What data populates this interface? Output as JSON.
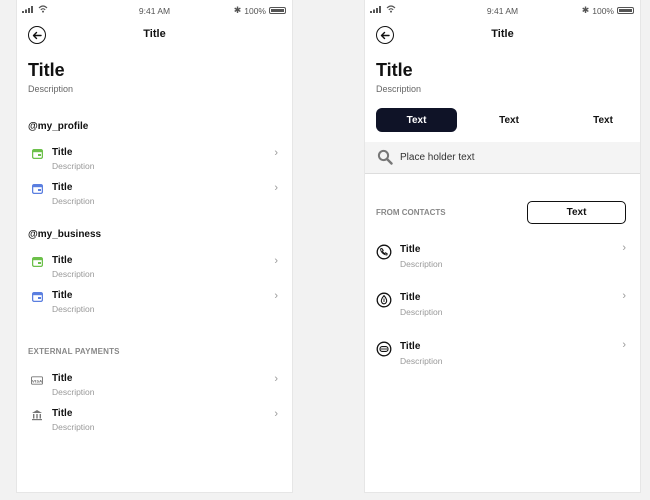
{
  "status_bar": {
    "time": "9:41 AM",
    "battery": "100%"
  },
  "left_screen": {
    "nav_title": "Title",
    "header": {
      "title": "Title",
      "description": "Description"
    },
    "section_profile": {
      "heading": "@my_profile",
      "items": [
        {
          "title": "Title",
          "description": "Description",
          "icon": "green-card-icon"
        },
        {
          "title": "Title",
          "description": "Description",
          "icon": "blue-card-icon"
        }
      ]
    },
    "section_business": {
      "heading": "@my_business",
      "items": [
        {
          "title": "Title",
          "description": "Description",
          "icon": "green-card-icon"
        },
        {
          "title": "Title",
          "description": "Description",
          "icon": "blue-card-icon"
        }
      ]
    },
    "section_external": {
      "heading": "EXTERNAL PAYMENTS",
      "items": [
        {
          "title": "Title",
          "description": "Description",
          "icon": "visa-card-icon"
        },
        {
          "title": "Title",
          "description": "Description",
          "icon": "bank-icon"
        }
      ]
    }
  },
  "right_screen": {
    "nav_title": "Title",
    "header": {
      "title": "Title",
      "description": "Description"
    },
    "segments": [
      "Text",
      "Text",
      "Text"
    ],
    "search": {
      "placeholder": "Place holder text"
    },
    "contacts": {
      "heading": "FROM CONTACTS",
      "button_label": "Text",
      "items": [
        {
          "title": "Title",
          "description": "Description",
          "icon": "phone-circle-icon"
        },
        {
          "title": "Title",
          "description": "Description",
          "icon": "drop-circle-icon"
        },
        {
          "title": "Title",
          "description": "Description",
          "icon": "mask-circle-icon"
        }
      ]
    }
  },
  "colors": {
    "accent_dark": "#0f1327",
    "green_icon": "#6cc04a",
    "blue_icon": "#5b7fe0"
  }
}
